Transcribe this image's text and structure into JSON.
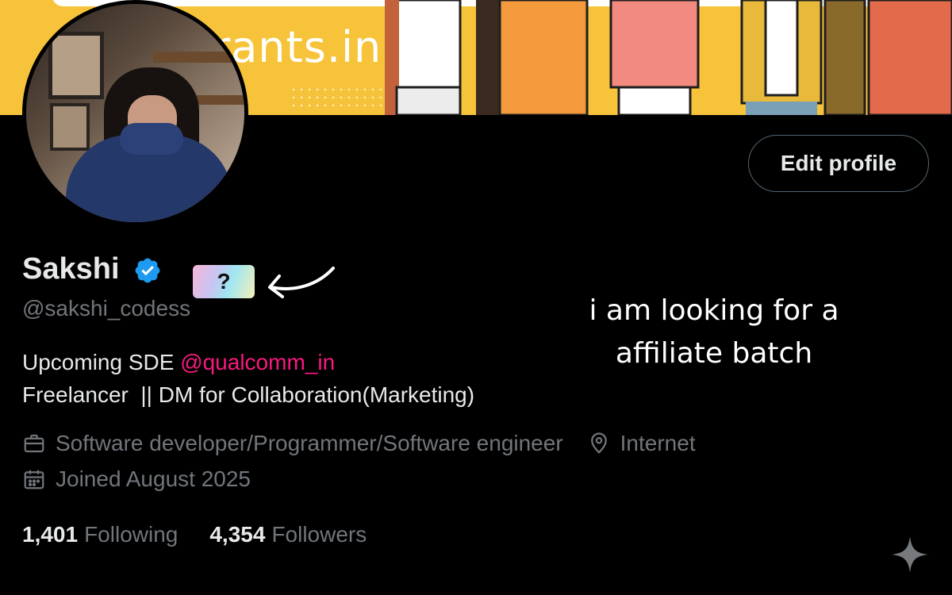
{
  "banner": {
    "brand_text": "rants.in"
  },
  "profile": {
    "name": "Sakshi",
    "handle": "@sakshi_codess",
    "edit_button": "Edit profile",
    "badge_text": "?",
    "bio": {
      "line1_prefix": "Upcoming SDE ",
      "line1_mention": "@qualcomm_in",
      "line2": "Freelancer  || DM for Collaboration(Marketing)"
    },
    "category": "Software developer/Programmer/Software engineer",
    "location": "Internet",
    "joined": "Joined August 2025",
    "following_count": "1,401",
    "following_label": "Following",
    "followers_count": "4,354",
    "followers_label": "Followers"
  },
  "overlay_note": {
    "line1": "i am looking for a",
    "line2": "affiliate batch"
  },
  "colors": {
    "background": "#000000",
    "verified": "#1d9bf0",
    "mention": "#f91880",
    "muted": "#71767b",
    "banner": "#f6c33a"
  },
  "icons": [
    "verified-icon",
    "briefcase-icon",
    "location-icon",
    "calendar-icon",
    "sparkle-icon",
    "arrow-icon"
  ]
}
